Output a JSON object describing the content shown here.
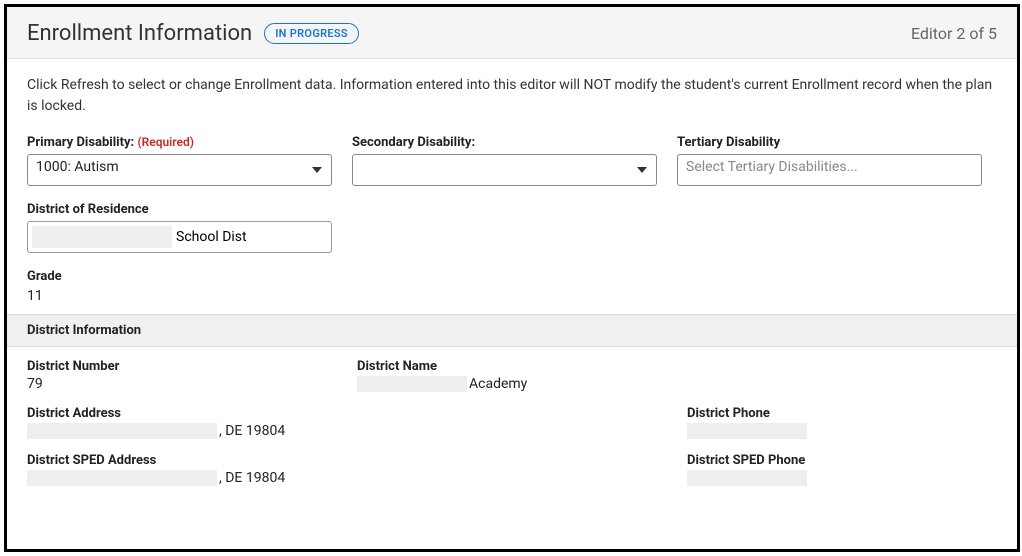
{
  "header": {
    "title": "Enrollment Information",
    "status_badge": "IN PROGRESS",
    "editor_counter": "Editor 2 of 5"
  },
  "intro": "Click Refresh to select or change Enrollment data. Information entered into this editor will NOT modify the student's current Enrollment record when the plan is locked.",
  "fields": {
    "primary_disability": {
      "label": "Primary Disability:",
      "required_text": "(Required)",
      "value": "1000: Autism"
    },
    "secondary_disability": {
      "label": "Secondary Disability:",
      "value": ""
    },
    "tertiary_disability": {
      "label": "Tertiary Disability",
      "placeholder": "Select Tertiary Disabilities..."
    },
    "district_of_residence": {
      "label": "District of Residence",
      "suffix": "School Dist"
    },
    "grade": {
      "label": "Grade",
      "value": "11"
    }
  },
  "district_section": {
    "header": "District Information",
    "district_number": {
      "label": "District Number",
      "value": "79"
    },
    "district_name": {
      "label": "District Name",
      "suffix": " Academy"
    },
    "district_address": {
      "label": "District Address",
      "suffix": ", DE 19804"
    },
    "district_phone": {
      "label": "District Phone"
    },
    "district_sped_address": {
      "label": "District SPED Address",
      "suffix": ", DE 19804"
    },
    "district_sped_phone": {
      "label": "District SPED Phone"
    }
  }
}
